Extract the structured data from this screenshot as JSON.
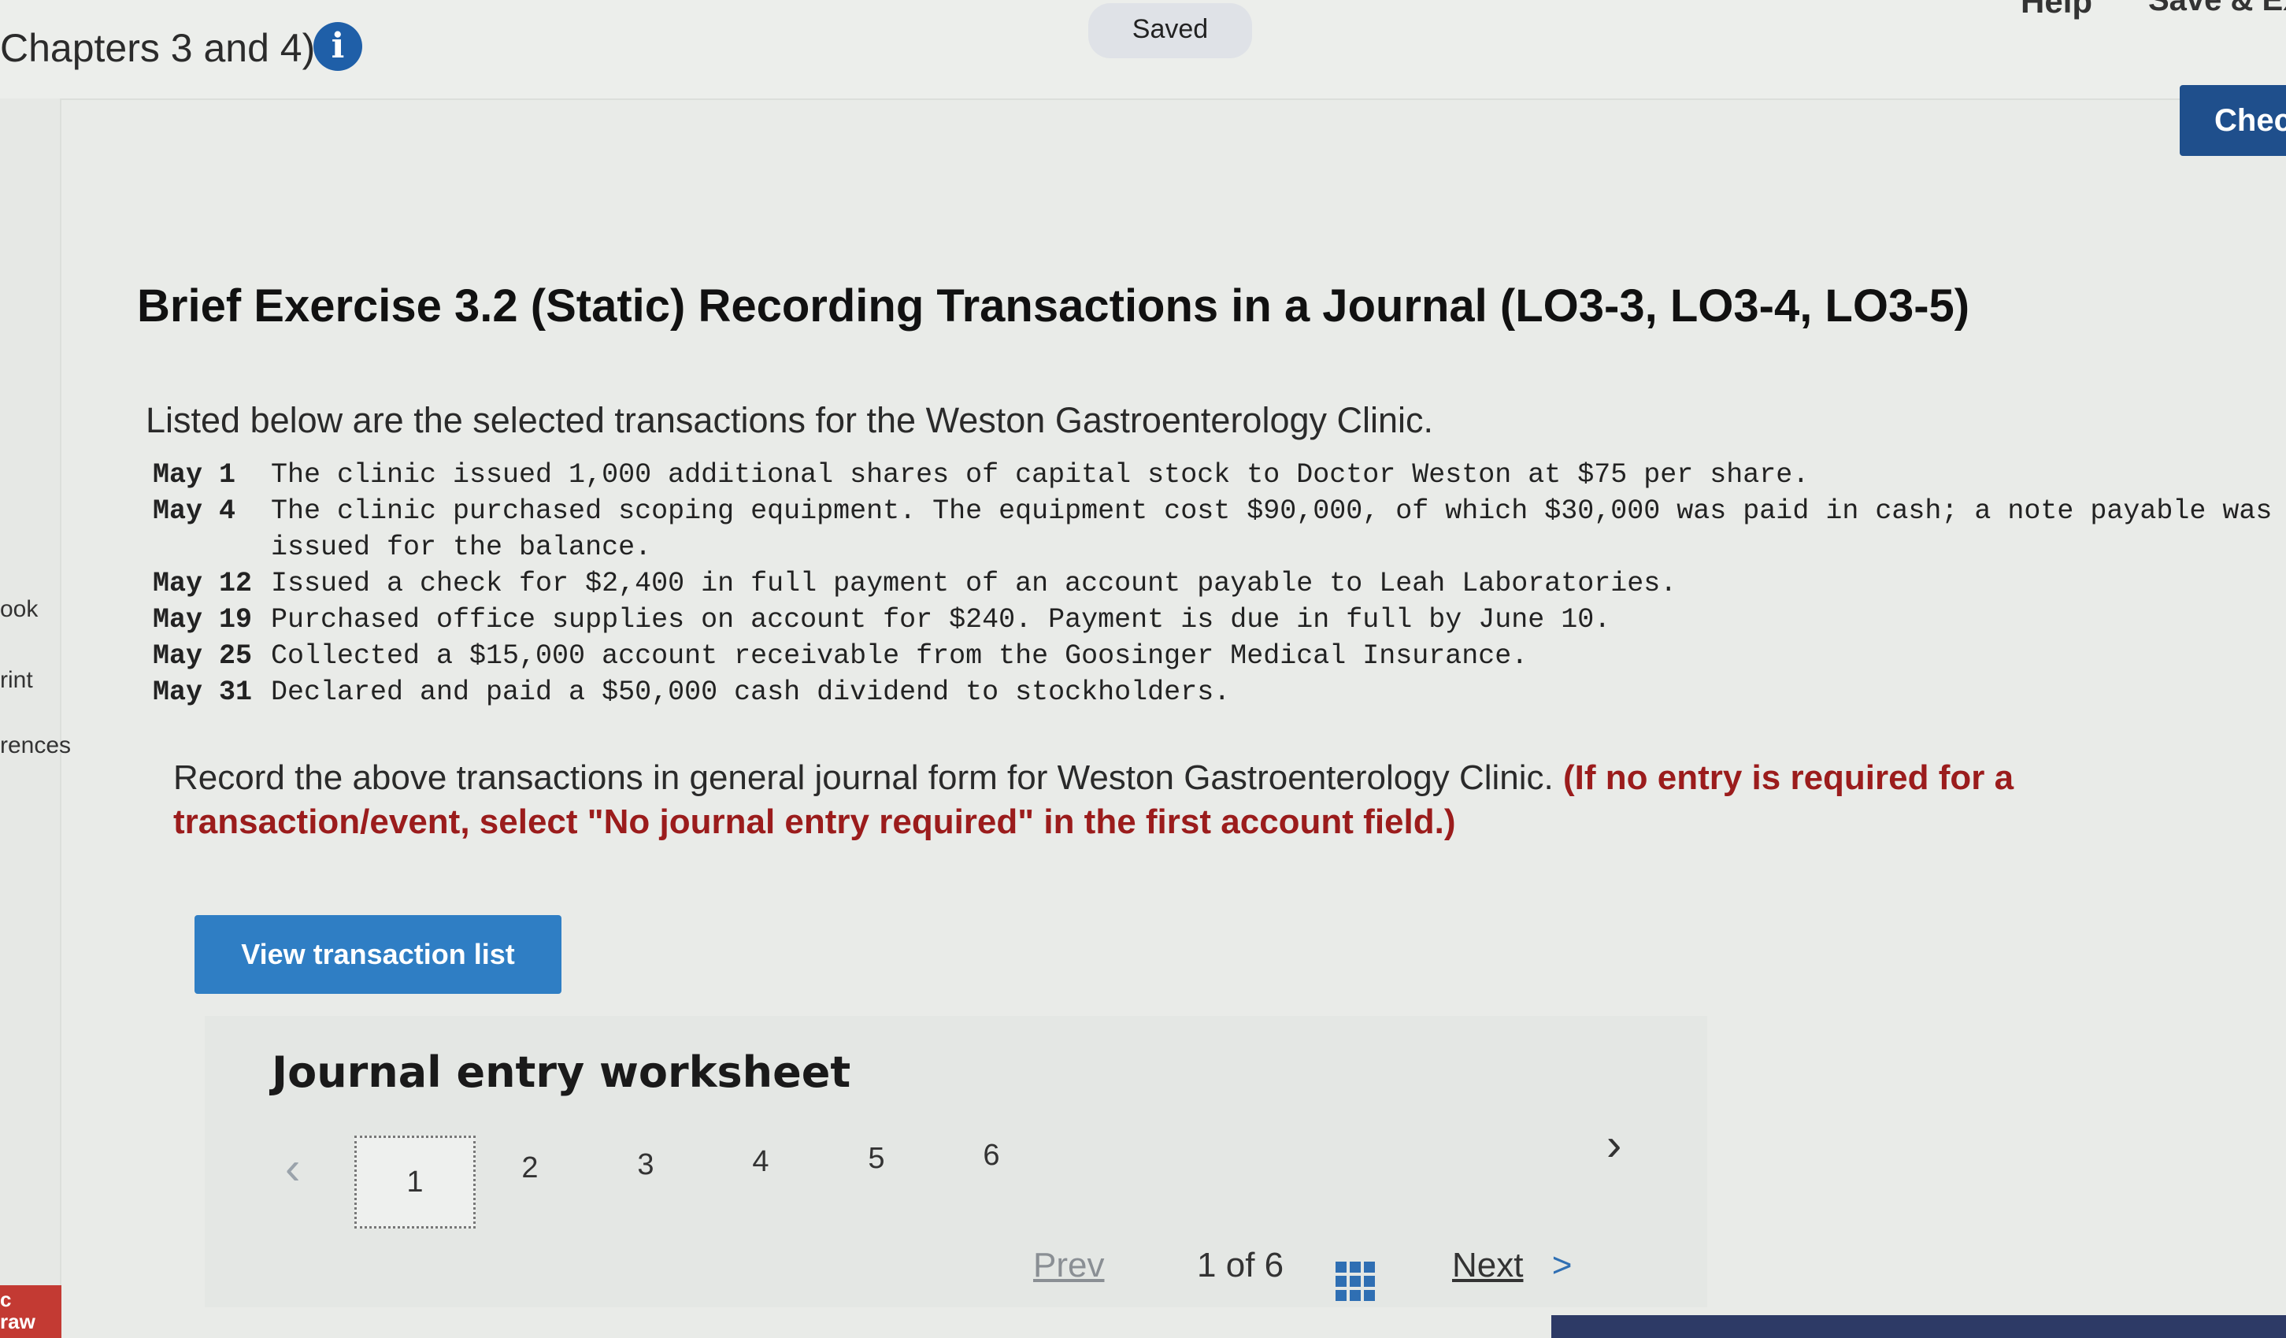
{
  "header": {
    "assignment_title": "Chapters 3 and 4)",
    "info_icon": "i",
    "saved_label": "Saved",
    "help_label": "Help",
    "save_exit_label": "Save & Ex",
    "check_label": "Chec"
  },
  "left_rail": {
    "items": [
      "ook",
      "rint",
      "rences"
    ],
    "badge_line1": "c",
    "badge_line2": "raw"
  },
  "exercise": {
    "title": "Brief Exercise 3.2 (Static) Recording Transactions in a Journal (LO3-3, LO3-4, LO3-5)",
    "intro": "Listed below are the selected transactions for the Weston Gastroenterology Clinic.",
    "transactions": [
      {
        "date": "May  1",
        "text": "The clinic issued 1,000 additional shares of capital stock to Doctor Weston at $75 per share.",
        "cont": ""
      },
      {
        "date": "May  4",
        "text": "The clinic purchased scoping equipment. The equipment cost $90,000, of which $30,000 was paid in cash; a note payable was",
        "cont": "issued for the balance."
      },
      {
        "date": "May 12",
        "text": "Issued a check for $2,400 in full payment of an account payable to Leah Laboratories.",
        "cont": ""
      },
      {
        "date": "May 19",
        "text": "Purchased office supplies on account for $240. Payment is due in full by June 10.",
        "cont": ""
      },
      {
        "date": "May 25",
        "text": "Collected a $15,000 account receivable from the Goosinger Medical Insurance.",
        "cont": ""
      },
      {
        "date": "May 31",
        "text": "Declared and paid a $50,000 cash dividend to stockholders.",
        "cont": ""
      }
    ],
    "instruction": "Record the above transactions in general journal form for Weston Gastroenterology Clinic.",
    "instruction_note": "(If no entry is required for a transaction/event, select \"No journal entry required\" in the first account field.)",
    "view_button": "View transaction list"
  },
  "worksheet": {
    "title": "Journal entry worksheet",
    "tabs": [
      "1",
      "2",
      "3",
      "4",
      "5",
      "6"
    ],
    "prev_icon": "chevron-left-icon",
    "next_icon": "chevron-right-icon"
  },
  "footer": {
    "prev": "Prev",
    "page_current": "1",
    "page_of": "of",
    "page_total": "6",
    "next": "Next",
    "next_arrow": ">"
  },
  "colors": {
    "primary_blue": "#2f7ec4",
    "dark_blue": "#1f4f8c",
    "note_red": "#9b1c1c",
    "background": "#e9ebe8"
  }
}
